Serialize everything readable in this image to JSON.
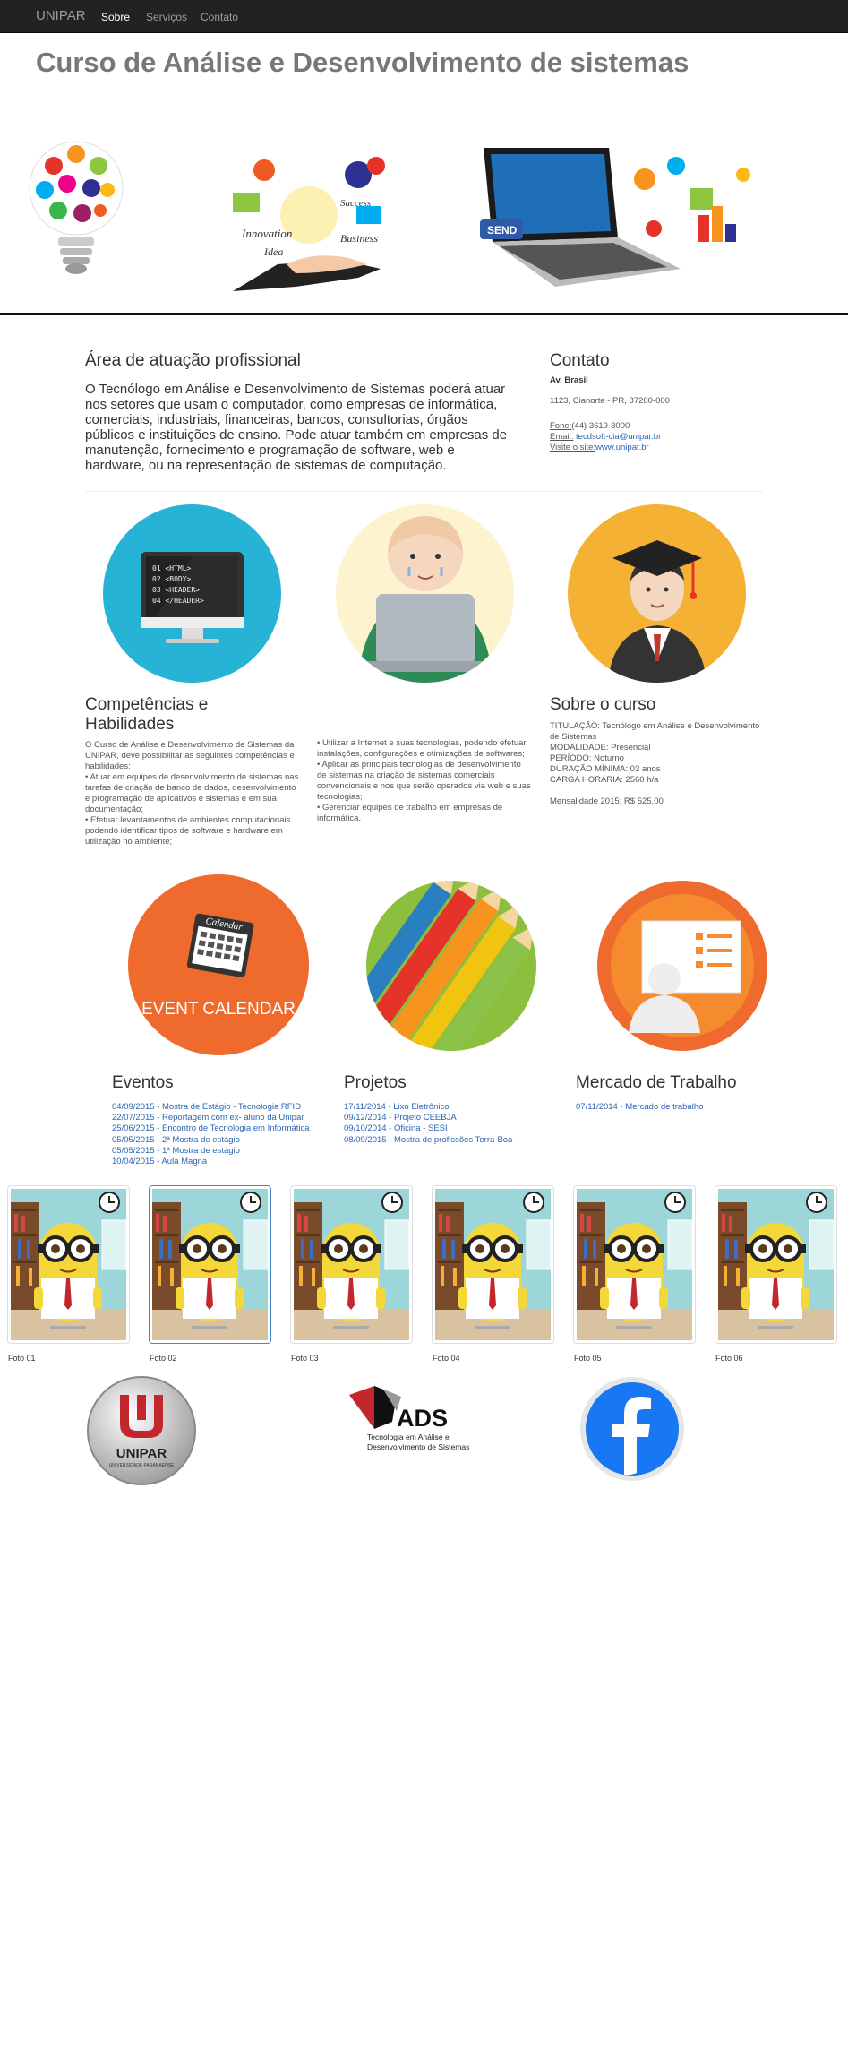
{
  "navbar": {
    "brand": "UNIPAR",
    "links": [
      {
        "label": "Sobre",
        "active": true
      },
      {
        "label": "Serviços",
        "active": false
      },
      {
        "label": "Contato",
        "active": false
      }
    ]
  },
  "page_title": "Curso de Análise e Desenvolvimento de sistemas",
  "area": {
    "title": "Área de atuação profissional",
    "text": "O Tecnólogo em Análise e Desenvolvimento de Sistemas poderá atuar nos setores que usam o computador, como empresas de informática, comerciais, industriais, financeiras, bancos, consultorias, órgãos públicos e instituições de ensino. Pode atuar também em empresas de manutenção, fornecimento e programação de software, web e hardware, ou na representação de sistemas de computação."
  },
  "contato": {
    "title": "Contato",
    "street": "Av. Brasil",
    "address": "1123, Cianorte - PR, 87200-000",
    "phone_label": "Fone:",
    "phone": "(44) 3619-3000",
    "email_label": "Email:",
    "email": "tecdsoft-cia@unipar.br",
    "site_label": "Visite o site:",
    "site": "www.unipar.br"
  },
  "competencias": {
    "title": "Competências e Habilidades",
    "col1": "O Curso de Análise e Desenvolvimento de Sistemas da UNIPAR, deve possibilitar as seguintes competências e habilidades:\n• Atuar em equipes de desenvolvimento de sistemas nas tarefas de criação de banco de dados, desenvolvimento e programação de aplicativos e sistemas e em sua documentação;\n• Efetuar levantamentos de ambientes computacionais podendo identificar tipos de software e hardware em utilização no ambiente;",
    "col2": "• Utilizar a Internet e suas tecnologias, podendo efetuar instalações, configurações e otimizações de softwares;\n• Aplicar as principais tecnologias de desenvolvimento de sistemas na criação de sistemas comerciais convencionais e nos que serão operados via web e suas tecnologias;\n• Gerenciar equipes de trabalho em empresas de informática."
  },
  "sobre_curso": {
    "title": "Sobre o curso",
    "lines": [
      "TITULAÇÃO: Tecnólogo em Análise e Desenvolvimento de Sistemas",
      "MODALIDADE: Presencial",
      "PERÍODO: Noturno",
      "DURAÇÃO MÍNIMA: 03 anos",
      "CARGA HORÁRIA: 2560 h/a"
    ],
    "mensalidade": "Mensalidade 2015: R$ 525,00"
  },
  "code_lines": [
    "01 <HTML>",
    "02 <BODY>",
    "03 <HEADER>",
    "04 </HEADER>"
  ],
  "calendar_label": "EVENT CALENDAR",
  "calendar_icon_text": "Calendar",
  "eventos": {
    "title": "Eventos",
    "items": [
      "04/09/2015 - Mostra de Estágio - Tecnologia RFID",
      "22/07/2015 - Reportagem com ex- aluno da Unipar",
      "25/06/2015 - Encontro de Tecnologia em Informática",
      "05/05/2015 - 2ª Mostra de estágio",
      "05/05/2015 - 1ª Mostra de estágio",
      "10/04/2015 - Aula Magna"
    ]
  },
  "projetos": {
    "title": "Projetos",
    "items": [
      "17/11/2014 - Lixo Eletrônico",
      "09/12/2014 - Projeto CEEBJA",
      "09/10/2014 - Oficina - SESI",
      "08/09/2015 - Mostra de profissões Terra-Boa"
    ]
  },
  "mercado": {
    "title": "Mercado de Trabalho",
    "items": [
      "07/11/2014 - Mercado de trabalho"
    ]
  },
  "fotos": [
    "Foto 01",
    "Foto 02",
    "Foto 03",
    "Foto 04",
    "Foto 05",
    "Foto 06"
  ],
  "footer": {
    "unipar": "UNIPAR",
    "unipar_sub": "UNIVERSIDADE PARANAENSE",
    "ads": "ADS",
    "ads_sub1": "Tecnologia em Análise e",
    "ads_sub2": "Desenvolvimento de Sistemas"
  },
  "colors": {
    "navbar": "#222222",
    "link": "#2a64b4",
    "blue_circle": "#27b3d6",
    "yellow_circle": "#f5b133",
    "orange_circle": "#ef6b2d",
    "green_circle": "#8dbf3f"
  }
}
